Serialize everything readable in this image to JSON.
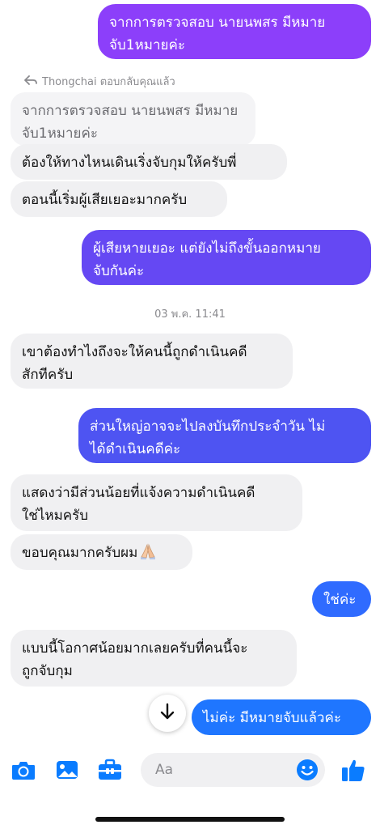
{
  "colors": {
    "accent": "#0a7cff",
    "gradient_top": "#8a3ffc",
    "gradient_mid": "#5b4cf0",
    "gradient_bottom": "#2f6bff",
    "incoming_bg": "#f0f0f2"
  },
  "reply_note": {
    "icon": "reply-arrow-icon",
    "text": "Thongchai ตอบกลับคุณแล้ว"
  },
  "messages": [
    {
      "id": "m1",
      "direction": "out",
      "text": "จากการตรวจสอบ นายนพสร มีหมาย\nจับ1หมายค่ะ"
    },
    {
      "id": "m2",
      "direction": "quoted",
      "text": "จากการตรวจสอบ นายนพสร มีหมาย\nจับ1หมายค่ะ"
    },
    {
      "id": "m3",
      "direction": "in",
      "text": "ต้องให้ทางไหนเดินเริ่งจับกุมให้ครับพี่"
    },
    {
      "id": "m4",
      "direction": "in",
      "text": "ตอนนี้เริ่มผู้เสียเยอะมากครับ"
    },
    {
      "id": "m5",
      "direction": "out",
      "text": "ผู้เสียหายเยอะ แต่ยังไม่ถึงขั้นออกหมาย\nจับกันค่ะ"
    },
    {
      "id": "m6",
      "direction": "in",
      "text": "เขาต้องทำไงถึงจะให้คนนี้ถูกดำเนินคดี\nสักทีครับ"
    },
    {
      "id": "m7",
      "direction": "out",
      "text": "ส่วนใหญ่อาจจะไปลงบันทึกประจำวัน ไม่\nได้ดำเนินคดีค่ะ"
    },
    {
      "id": "m8",
      "direction": "in",
      "text": "แสดงว่ามีส่วนน้อยที่แจ้งความดำเนินคดี\nใช่ไหมครับ"
    },
    {
      "id": "m9",
      "direction": "in",
      "text": "ขอบคุณมากครับผม",
      "emoji": "folded-hands-icon"
    },
    {
      "id": "m10",
      "direction": "out",
      "text": "ใช่ค่ะ"
    },
    {
      "id": "m11",
      "direction": "in",
      "text": "แบบนี้โอกาศน้อยมากเลยครับที่คนนี้จะ\nถูกจับกุม"
    },
    {
      "id": "m12",
      "direction": "out",
      "text": "ไม่ค่ะ มีหมายจับแล้วค่ะ"
    }
  ],
  "timestamp": "03 พ.ค. 11:41",
  "scroll_button_icon": "arrow-down-icon",
  "bottom_bar": {
    "icons": [
      "camera-icon",
      "image-icon",
      "toolbox-icon",
      "emoji-icon",
      "thumbs-up-icon"
    ],
    "composer_placeholder": "Aa"
  }
}
